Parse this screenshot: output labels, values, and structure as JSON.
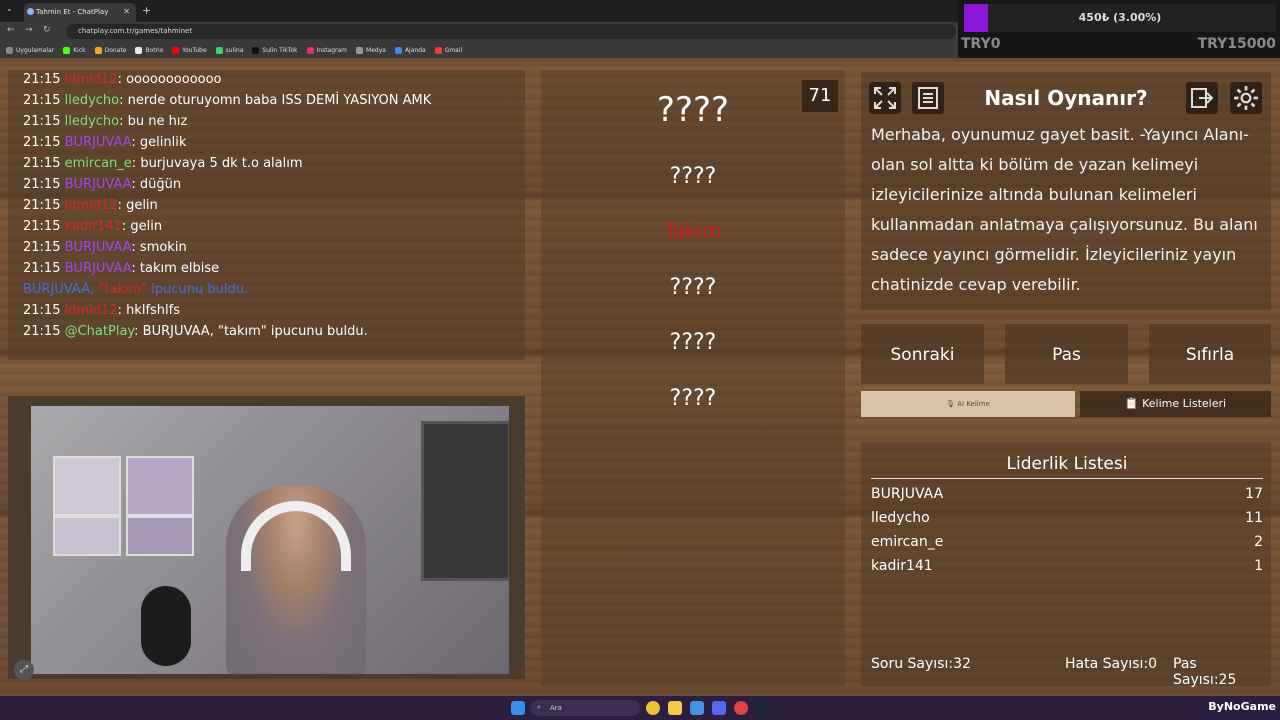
{
  "browser": {
    "tab_title": "Tahmin Et - ChatPlay",
    "url": "chatplay.com.tr/games/tahminet",
    "bookmarks": [
      "Uygulamalar",
      "Kick",
      "Donate",
      "Botrix",
      "YouTube",
      "sulina",
      "Sulin TikTok",
      "Instagram",
      "Medya",
      "Ajanda",
      "Gmail"
    ],
    "bookmark_colors": [
      "#888888",
      "#53fc18",
      "#f5a623",
      "#e8e8e8",
      "#ff0000",
      "#3fd46a",
      "#111111",
      "#e1306c",
      "#999999",
      "#4285f4",
      "#ea4335"
    ]
  },
  "donation": {
    "progress_text": "450₺ (3.00%)",
    "progress_fraction": 0.03,
    "min_label": "TRY0",
    "max_label": "TRY15000",
    "fill_color": "#8a18d6"
  },
  "chat": {
    "lines": [
      {
        "time": "21:15",
        "user": "ldmld12",
        "user_color": "red",
        "sep": ": ",
        "msg": "oooooooooooo"
      },
      {
        "time": "21:15",
        "user": "lledycho",
        "user_color": "green",
        "sep": ": ",
        "msg": "nerde oturuyomn baba ISS DEMİ YASIYON AMK"
      },
      {
        "time": "21:15",
        "user": "lledycho",
        "user_color": "green",
        "sep": ": ",
        "msg": "bu ne hız"
      },
      {
        "time": "21:15",
        "user": "BURJUVAA",
        "user_color": "purple",
        "sep": ": ",
        "msg": "gelinlik"
      },
      {
        "time": "21:15",
        "user": "emircan_e",
        "user_color": "green",
        "sep": ": ",
        "msg": "burjuvaya 5 dk t.o alalım"
      },
      {
        "time": "21:15",
        "user": "BURJUVAA",
        "user_color": "purple",
        "sep": ": ",
        "msg": "düğün"
      },
      {
        "time": "21:15",
        "user": "ldmld12",
        "user_color": "red",
        "sep": ": ",
        "msg": "gelin"
      },
      {
        "time": "21:15",
        "user": "kadir141",
        "user_color": "red",
        "sep": ": ",
        "msg": "gelin"
      },
      {
        "time": "21:15",
        "user": "BURJUVAA",
        "user_color": "purple",
        "sep": ": ",
        "msg": "smokin"
      },
      {
        "time": "21:15",
        "user": "BURJUVAA",
        "user_color": "purple",
        "sep": ": ",
        "msg": "takım elbise"
      },
      {
        "time": "21:15",
        "user": "ldmld12",
        "user_color": "red",
        "sep": ": ",
        "msg": "hklfshlfs"
      },
      {
        "time": "21:15",
        "user": "@ChatPlay",
        "user_color": "green",
        "sep": ": ",
        "msg": "BURJUVAA, \"takım\" ipucunu buldu."
      }
    ],
    "system_line": {
      "user": "BURJUVAA, ",
      "hint": "\"takım\"",
      "msg": " ipucunu buldu."
    }
  },
  "words": {
    "main": "????",
    "items": [
      "????",
      "Takım",
      "????",
      "????",
      "????"
    ],
    "found_color": "#c81e1e",
    "counter": "71"
  },
  "howto": {
    "title": "Nasıl Oynanır?",
    "description": "Merhaba, oyunumuz gayet basit. -Yayıncı Alanı- olan sol altta ki bölüm de yazan kelimeyi izleyicilerinize altında bulunan kelimeleri kullanmadan anlatmaya çalışıyorsunuz. Bu alanı sadece yayıncı görmelidir. İzleyicileriniz yayın chatinizde cevap verebilir.",
    "icons": [
      "fullscreen-icon",
      "list-icon",
      "exit-icon",
      "gear-icon"
    ]
  },
  "controls": {
    "next": "Sonraki",
    "pass": "Pas",
    "reset": "Sıfırla",
    "ai_tab": "AI Kelime",
    "lists_tab": "Kelime Listeleri"
  },
  "leaderboard": {
    "title": "Liderlik Listesi",
    "rows": [
      {
        "name": "BURJUVAA",
        "score": "17"
      },
      {
        "name": "lledycho",
        "score": "11"
      },
      {
        "name": "emircan_e",
        "score": "2"
      },
      {
        "name": "kadir141",
        "score": "1"
      }
    ]
  },
  "stats": {
    "questions_label": "Soru Sayısı:",
    "questions": "32",
    "errors_label": "Hata Sayısı:",
    "errors": "0",
    "passes_label": "Pas Sayısı:",
    "passes": "25"
  },
  "taskbar": {
    "search_placeholder": "Ara",
    "watermark": "ByNoGame"
  }
}
